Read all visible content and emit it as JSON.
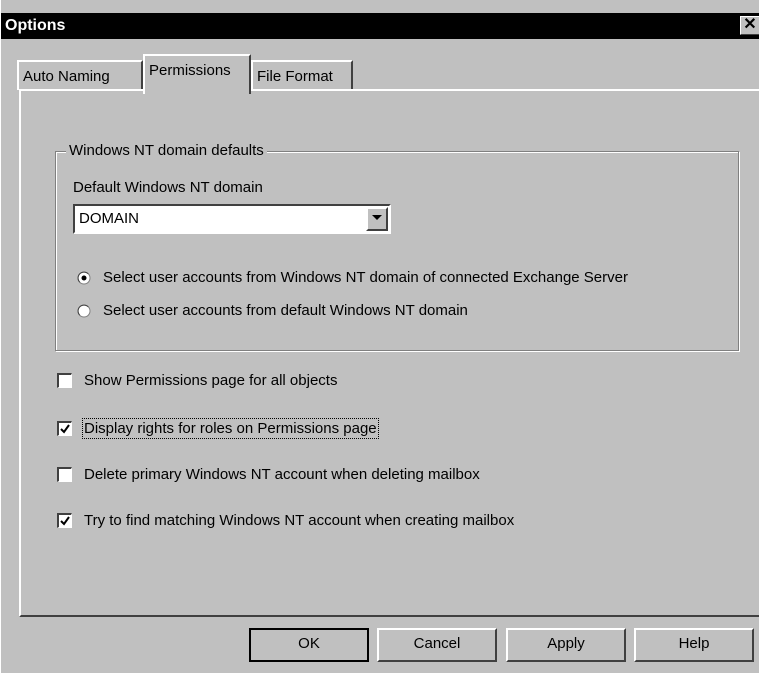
{
  "window": {
    "title": "Options",
    "close_glyph": "✕"
  },
  "tabs": [
    {
      "label": "Auto Naming",
      "selected": false
    },
    {
      "label": "Permissions",
      "selected": true
    },
    {
      "label": "File Format",
      "selected": false
    }
  ],
  "group": {
    "legend": "Windows NT domain defaults",
    "domain_label": "Default Windows NT domain",
    "domain_value": "DOMAIN",
    "radios": [
      {
        "label": "Select user accounts from Windows NT domain of connected Exchange Server",
        "checked": true
      },
      {
        "label": "Select user accounts from default Windows NT domain",
        "checked": false
      }
    ]
  },
  "checkboxes": [
    {
      "label": "Show Permissions page for all objects",
      "checked": false
    },
    {
      "label": "Display rights for roles on Permissions page",
      "checked": true
    },
    {
      "label": "Delete primary Windows NT account when deleting mailbox",
      "checked": false
    },
    {
      "label": "Try to find matching Windows NT account when creating mailbox",
      "checked": true
    }
  ],
  "buttons": {
    "ok": "OK",
    "cancel": "Cancel",
    "apply": "Apply",
    "help": "Help"
  },
  "colors": {
    "face": "#c0c0c0",
    "titlebar": "#000000"
  },
  "icons": {
    "close": "close-icon",
    "dropdown": "chevron-down-icon",
    "radio": "radio-icon",
    "checkmark": "checkmark-icon"
  }
}
